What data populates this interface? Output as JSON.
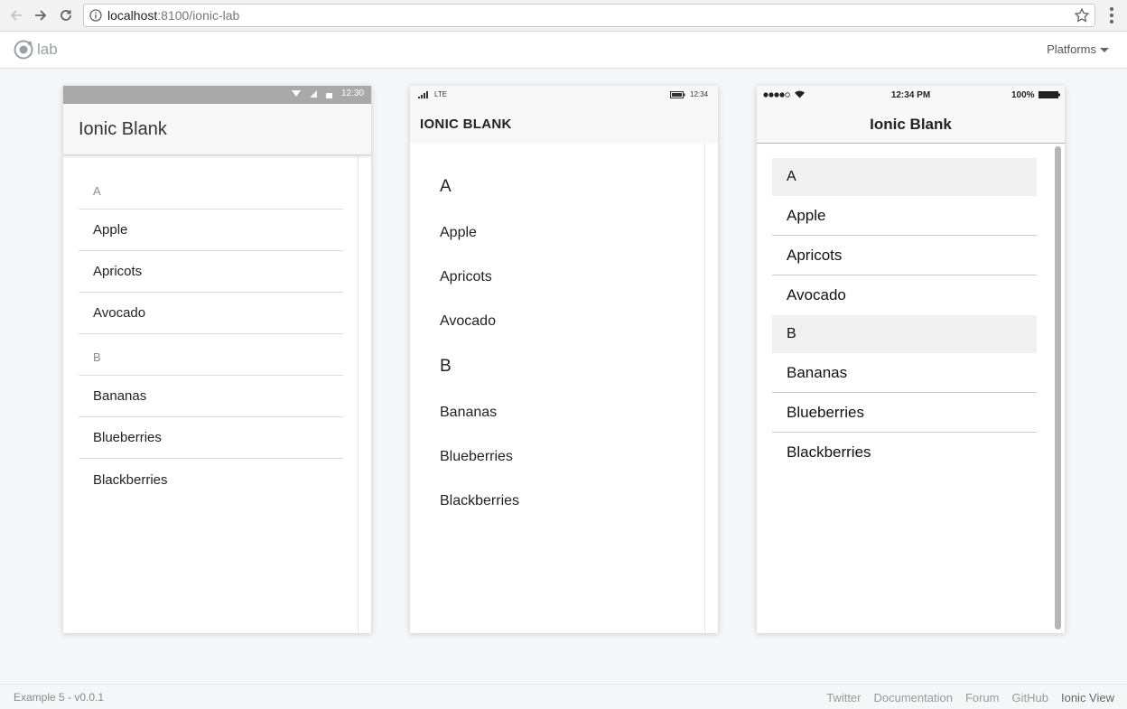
{
  "browser": {
    "url_host": "localhost",
    "url_path": ":8100/ionic-lab"
  },
  "lab": {
    "logo_text": "lab",
    "platforms_label": "Platforms"
  },
  "android": {
    "time": "12:30",
    "title": "Ionic Blank",
    "groups": [
      {
        "header": "A",
        "items": [
          "Apple",
          "Apricots",
          "Avocado"
        ]
      },
      {
        "header": "B",
        "items": [
          "Bananas",
          "Blueberries",
          "Blackberries"
        ]
      }
    ]
  },
  "windows": {
    "network": "LTE",
    "time": "12:34",
    "title": "IONIC BLANK",
    "groups": [
      {
        "header": "A",
        "items": [
          "Apple",
          "Apricots",
          "Avocado"
        ]
      },
      {
        "header": "B",
        "items": [
          "Bananas",
          "Blueberries",
          "Blackberries"
        ]
      }
    ]
  },
  "ios": {
    "time": "12:34 PM",
    "battery": "100%",
    "title": "Ionic Blank",
    "groups": [
      {
        "header": "A",
        "items": [
          "Apple",
          "Apricots",
          "Avocado"
        ]
      },
      {
        "header": "B",
        "items": [
          "Bananas",
          "Blueberries",
          "Blackberries"
        ]
      }
    ]
  },
  "footer": {
    "version": "Example 5 - v0.0.1",
    "links": [
      "Twitter",
      "Documentation",
      "Forum",
      "GitHub",
      "Ionic View"
    ]
  }
}
